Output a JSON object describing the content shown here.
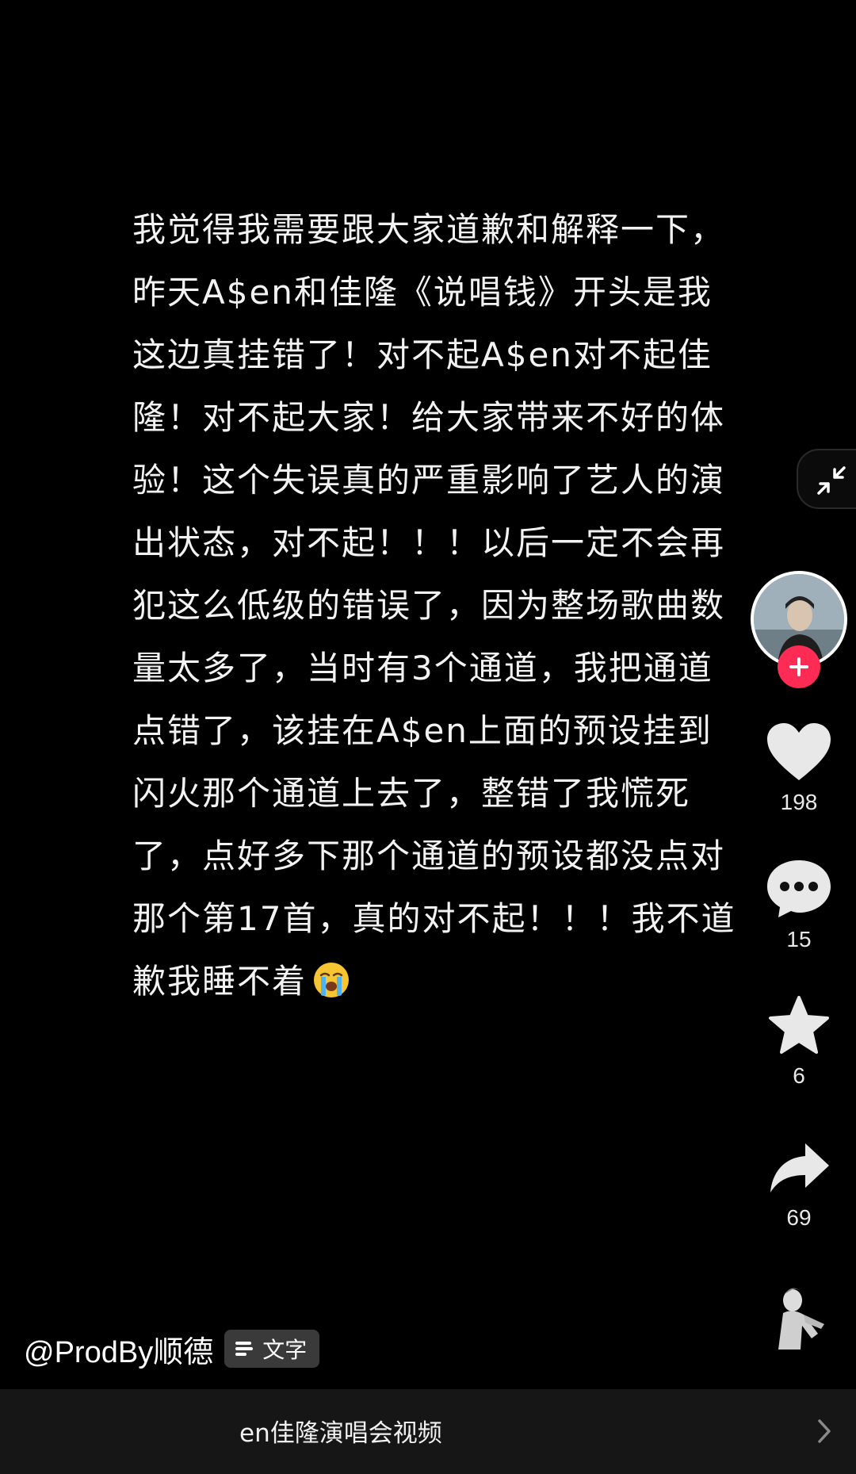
{
  "post": {
    "lines": [
      "我觉得我需要跟大家道歉和解释一下，",
      "昨天A$en和佳隆《说唱钱》开头是我",
      "这边真挂错了！对不起A$en对不起佳",
      "隆！对不起大家！给大家带来不好的体",
      "验！这个失误真的严重影响了艺人的演",
      "出状态，对不起！！！以后一定不会再",
      "犯这么低级的错误了，因为整场歌曲数",
      "量太多了，当时有3个通道，我把通道",
      "点错了，该挂在A$en上面的预设挂到",
      "闪火那个通道上去了，整错了我慌死",
      "了，点好多下那个通道的预设都没点对",
      "那个第17首，真的对不起！！！我不道",
      "歉我睡不着"
    ],
    "emoji": "crying-face-emoji"
  },
  "sidebar": {
    "likes": "198",
    "comments": "15",
    "favorites": "6",
    "shares": "69"
  },
  "author": {
    "handle": "@ProdBy顺德",
    "tag_label": "文字"
  },
  "bottom_bar": {
    "related_title": "en佳隆演唱会视频"
  },
  "colors": {
    "background": "#000000",
    "follow_accent": "#fe2c55",
    "bottom_bar": "#161616"
  },
  "icons": [
    "collapse-icon",
    "plus-icon",
    "heart-icon",
    "comment-icon",
    "star-icon",
    "share-icon",
    "list-icon",
    "chevron-right-icon"
  ]
}
